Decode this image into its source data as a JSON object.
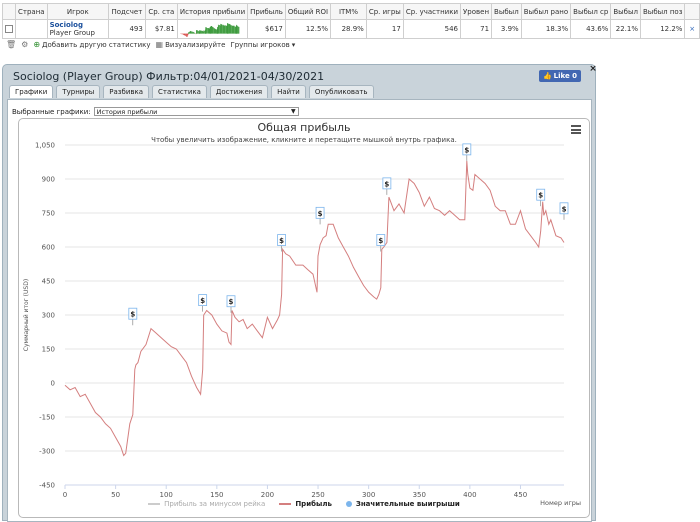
{
  "table": {
    "headers": [
      "Страна",
      "Игрок",
      "Подсчет",
      "Ср. ста",
      "История прибыли",
      "Прибыль",
      "Общий ROI",
      "ITM%",
      "Ср. игры",
      "Ср. участники",
      "Уровен",
      "Выбыл",
      "Выбыл рано",
      "Выбыл ср",
      "Выбыл",
      "Выбыл поз"
    ],
    "row": {
      "player_name": "Sociolog",
      "player_group": "Player Group",
      "count": "493",
      "avg_stake": "$7.81",
      "profit": "$617",
      "roi": "12.5%",
      "itm": "28.9%",
      "avg_games": "17",
      "avg_entrants": "546",
      "level": "71",
      "out1": "3.9%",
      "out_early": "18.3%",
      "out_mid": "43.6%",
      "out2": "22.1%",
      "out_late": "12.2%",
      "remove": "×"
    }
  },
  "toolbar": {
    "add_stat": "Добавить другую статистику",
    "visualize": "Визуализируйте",
    "groups": "Группы игроков",
    "groups_caret": "▾"
  },
  "panel": {
    "title": "Sociolog (Player Group) Фильтр:04/01/2021-04/30/2021",
    "close": "×",
    "fb_like": "Like 0",
    "tabs": [
      "Графики",
      "Турниры",
      "Разбивка",
      "Статистика",
      "Достижения",
      "Найти",
      "Опубликовать"
    ],
    "selected_label": "Выбранные графики:",
    "selected_value": "История прибыли"
  },
  "colors": {
    "profit_line": "#d47f7f",
    "rake_line": "#cccccc",
    "big_wins": "#7cb5ec",
    "sparkline": "#3d9b3d"
  },
  "chart_data": {
    "type": "line",
    "title": "Общая прибыль",
    "subtitle": "Чтобы увеличить изображение, кликните и перетащите мышкой внутрь графика.",
    "xlabel": "Номер игры",
    "ylabel": "Суммарный итог (USD)",
    "xlim": [
      0,
      493
    ],
    "ylim": [
      -450,
      1050
    ],
    "x_ticks": [
      0,
      50,
      100,
      150,
      200,
      250,
      300,
      350,
      400,
      450
    ],
    "y_ticks": [
      -450,
      -300,
      -150,
      0,
      150,
      300,
      450,
      600,
      750,
      900,
      1050
    ],
    "y_tick_labels": [
      "-450",
      "-300",
      "-150",
      "0",
      "150",
      "300",
      "450",
      "600",
      "750",
      "900",
      "1,050"
    ],
    "legend": [
      "Прибыль за минусом рейка",
      "Прибыль",
      "Значительные выигрыши"
    ],
    "legend_placement": "bottom",
    "series": [
      {
        "name": "Прибыль",
        "x": [
          0,
          5,
          10,
          15,
          20,
          25,
          30,
          35,
          40,
          45,
          50,
          55,
          58,
          60,
          64,
          67,
          69,
          70,
          72,
          75,
          80,
          85,
          90,
          95,
          100,
          105,
          110,
          115,
          120,
          125,
          130,
          134,
          136,
          137,
          140,
          145,
          150,
          155,
          160,
          162,
          164,
          165,
          168,
          172,
          176,
          180,
          185,
          190,
          195,
          200,
          205,
          210,
          212,
          214,
          215,
          218,
          222,
          228,
          235,
          240,
          245,
          249,
          250,
          252,
          255,
          258,
          260,
          265,
          270,
          275,
          280,
          285,
          290,
          295,
          300,
          305,
          308,
          310,
          312,
          313,
          315,
          318,
          320,
          325,
          330,
          335,
          340,
          345,
          350,
          355,
          360,
          365,
          370,
          375,
          380,
          385,
          390,
          395,
          397,
          398,
          400,
          403,
          405,
          410,
          415,
          420,
          425,
          430,
          435,
          440,
          445,
          450,
          455,
          460,
          465,
          468,
          470,
          472,
          473,
          475,
          478,
          480,
          485,
          490,
          493
        ],
        "y": [
          -10,
          -30,
          -20,
          -60,
          -50,
          -90,
          -130,
          -150,
          -180,
          -200,
          -240,
          -280,
          -320,
          -310,
          -180,
          -140,
          60,
          80,
          90,
          140,
          170,
          240,
          220,
          200,
          180,
          160,
          150,
          120,
          90,
          30,
          -20,
          -50,
          60,
          300,
          320,
          300,
          260,
          230,
          220,
          180,
          170,
          320,
          290,
          270,
          280,
          240,
          260,
          230,
          200,
          290,
          240,
          280,
          300,
          390,
          590,
          570,
          560,
          520,
          520,
          500,
          480,
          400,
          560,
          610,
          640,
          650,
          700,
          700,
          640,
          600,
          560,
          510,
          470,
          430,
          400,
          380,
          370,
          390,
          420,
          590,
          600,
          620,
          820,
          760,
          790,
          750,
          900,
          880,
          840,
          780,
          820,
          770,
          760,
          740,
          760,
          740,
          720,
          720,
          980,
          920,
          860,
          850,
          920,
          900,
          880,
          850,
          780,
          760,
          760,
          700,
          700,
          760,
          680,
          650,
          620,
          600,
          670,
          800,
          740,
          760,
          700,
          720,
          650,
          640,
          620
        ]
      }
    ],
    "big_wins": [
      {
        "x": 67,
        "y": 255,
        "label": "$"
      },
      {
        "x": 136,
        "y": 315,
        "label": "$"
      },
      {
        "x": 164,
        "y": 310,
        "label": "$"
      },
      {
        "x": 214,
        "y": 580,
        "label": "$"
      },
      {
        "x": 252,
        "y": 700,
        "label": "$"
      },
      {
        "x": 312,
        "y": 580,
        "label": "$"
      },
      {
        "x": 318,
        "y": 830,
        "label": "$"
      },
      {
        "x": 397,
        "y": 980,
        "label": "$"
      },
      {
        "x": 470,
        "y": 780,
        "label": "$"
      },
      {
        "x": 493,
        "y": 720,
        "label": "$"
      }
    ]
  }
}
